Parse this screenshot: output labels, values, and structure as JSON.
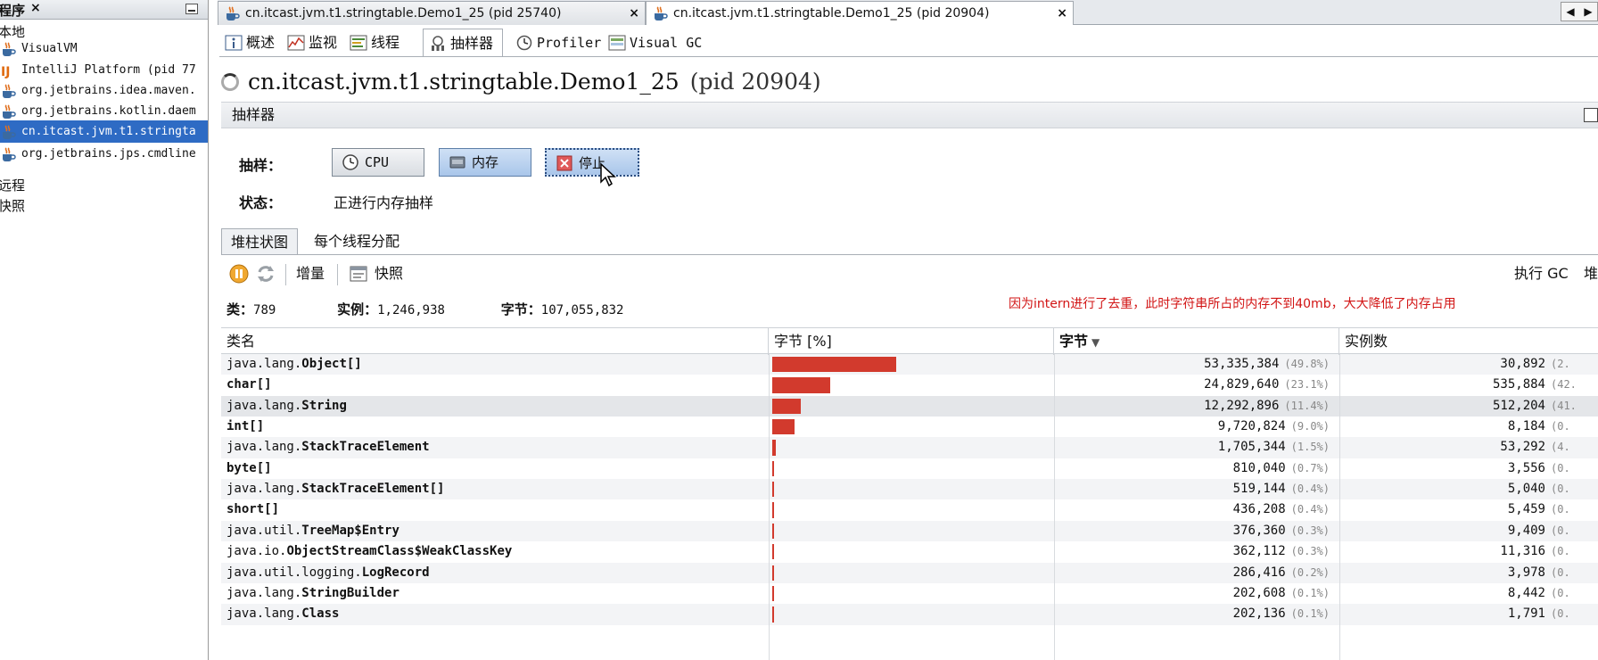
{
  "left_panel": {
    "title": "程序",
    "close": "×",
    "items": [
      {
        "label": "本地",
        "kind": "group"
      },
      {
        "label": "VisualVM",
        "kind": "java"
      },
      {
        "label": "IntelliJ Platform (pid 77",
        "kind": "intellij"
      },
      {
        "label": "org.jetbrains.idea.maven.",
        "kind": "java"
      },
      {
        "label": "org.jetbrains.kotlin.daem",
        "kind": "java"
      },
      {
        "label": "cn.itcast.jvm.t1.stringta",
        "kind": "java",
        "selected": true
      },
      {
        "label": "org.jetbrains.jps.cmdline",
        "kind": "java"
      },
      {
        "label": "远程",
        "kind": "group"
      },
      {
        "label": "快照",
        "kind": "group"
      }
    ]
  },
  "doc_tabs": [
    {
      "label": "cn.itcast.jvm.t1.stringtable.Demo1_25 (pid 25740)",
      "close": "×",
      "active": false
    },
    {
      "label": "cn.itcast.jvm.t1.stringtable.Demo1_25 (pid 20904)",
      "close": "×",
      "active": true
    }
  ],
  "nav": {
    "prev": "◀",
    "next": "▶"
  },
  "view_tabs": [
    {
      "label": "概述",
      "icon": "overview-icon"
    },
    {
      "label": "监视",
      "icon": "monitor-icon"
    },
    {
      "label": "线程",
      "icon": "threads-icon"
    },
    {
      "label": "抽样器",
      "icon": "sampler-icon",
      "active": true
    },
    {
      "label": "Profiler",
      "icon": "profiler-icon"
    },
    {
      "label": "Visual GC",
      "icon": "visualgc-icon"
    }
  ],
  "title": {
    "name": "cn.itcast.jvm.t1.stringtable.Demo1_25",
    "pid": "(pid 20904)"
  },
  "sampler": {
    "section_title": "抽样器",
    "sample_label": "抽样：",
    "status_label": "状态：",
    "status_value": "正进行内存抽样",
    "buttons": {
      "cpu": "CPU",
      "memory": "内存",
      "stop": "停止"
    }
  },
  "sub_tabs": [
    {
      "label": "堆柱状图",
      "active": true
    },
    {
      "label": "每个线程分配"
    }
  ],
  "toolbar": {
    "delta": "增量",
    "snapshot": "快照",
    "gc": "执行 GC",
    "heap": "堆"
  },
  "summary": {
    "classes_label": "类：",
    "classes_value": "789",
    "instances_label": "实例：",
    "instances_value": "1,246,938",
    "bytes_label": "字节：",
    "bytes_value": "107,055,832"
  },
  "annotation": "因为intern进行了去重，此时字符串所占的内存不到40mb，大大降低了内存占用",
  "table": {
    "headers": {
      "name": "类名",
      "bytes_pct": "字节 [%]",
      "bytes": "字节",
      "instances": "实例数"
    },
    "sort_indicator": "▼",
    "rows": [
      {
        "pkg": "java.lang.",
        "cls": "Object[]",
        "fraction": 0.498,
        "bytes": "53,335,384",
        "pct": "(49.8%)",
        "instances": "30,892",
        "inst_pct": "(2."
      },
      {
        "pkg": "",
        "cls": "char[]",
        "fraction": 0.231,
        "bytes": "24,829,640",
        "pct": "(23.1%)",
        "instances": "535,884",
        "inst_pct": "(42."
      },
      {
        "pkg": "java.lang.",
        "cls": "String",
        "fraction": 0.114,
        "bytes": "12,292,896",
        "pct": "(11.4%)",
        "instances": "512,204",
        "inst_pct": "(41.",
        "selected": true
      },
      {
        "pkg": "",
        "cls": "int[]",
        "fraction": 0.09,
        "bytes": "9,720,824",
        "pct": "(9.0%)",
        "instances": "8,184",
        "inst_pct": "(0."
      },
      {
        "pkg": "java.lang.",
        "cls": "StackTraceElement",
        "fraction": 0.015,
        "bytes": "1,705,344",
        "pct": "(1.5%)",
        "instances": "53,292",
        "inst_pct": "(4."
      },
      {
        "pkg": "",
        "cls": "byte[]",
        "fraction": 0.007,
        "bytes": "810,040",
        "pct": "(0.7%)",
        "instances": "3,556",
        "inst_pct": "(0."
      },
      {
        "pkg": "java.lang.",
        "cls": "StackTraceElement[]",
        "fraction": 0.004,
        "bytes": "519,144",
        "pct": "(0.4%)",
        "instances": "5,040",
        "inst_pct": "(0."
      },
      {
        "pkg": "",
        "cls": "short[]",
        "fraction": 0.004,
        "bytes": "436,208",
        "pct": "(0.4%)",
        "instances": "5,459",
        "inst_pct": "(0."
      },
      {
        "pkg": "java.util.",
        "cls": "TreeMap$Entry",
        "fraction": 0.003,
        "bytes": "376,360",
        "pct": "(0.3%)",
        "instances": "9,409",
        "inst_pct": "(0."
      },
      {
        "pkg": "java.io.",
        "cls": "ObjectStreamClass$WeakClassKey",
        "fraction": 0.003,
        "bytes": "362,112",
        "pct": "(0.3%)",
        "instances": "11,316",
        "inst_pct": "(0."
      },
      {
        "pkg": "java.util.logging.",
        "cls": "LogRecord",
        "fraction": 0.002,
        "bytes": "286,416",
        "pct": "(0.2%)",
        "instances": "3,978",
        "inst_pct": "(0."
      },
      {
        "pkg": "java.lang.",
        "cls": "StringBuilder",
        "fraction": 0.001,
        "bytes": "202,608",
        "pct": "(0.1%)",
        "instances": "8,442",
        "inst_pct": "(0."
      },
      {
        "pkg": "java.lang.",
        "cls": "Class",
        "fraction": 0.001,
        "bytes": "202,136",
        "pct": "(0.1%)",
        "instances": "1,791",
        "inst_pct": "(0."
      }
    ]
  },
  "colors": {
    "bar": "#d23a2d",
    "selection": "#2e6bc4",
    "annotation": "#d21414"
  }
}
